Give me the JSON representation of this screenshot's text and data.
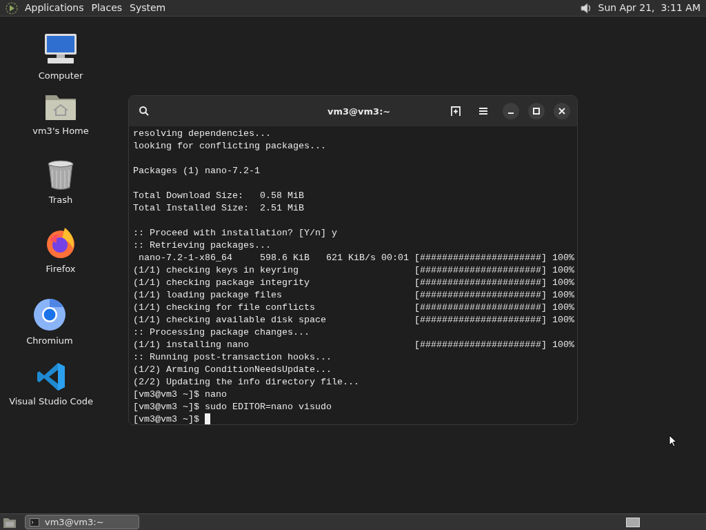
{
  "top_panel": {
    "menus": [
      "Applications",
      "Places",
      "System"
    ],
    "clock": "Sun Apr 21,  3:11 AM"
  },
  "desktop_icons": [
    {
      "kind": "computer",
      "label": "Computer"
    },
    {
      "kind": "home",
      "label": "vm3's Home"
    },
    {
      "kind": "trash",
      "label": "Trash"
    },
    {
      "kind": "firefox",
      "label": "Firefox"
    },
    {
      "kind": "chromium",
      "label": "Chromium"
    },
    {
      "kind": "vscode",
      "label": "Visual Studio Code"
    }
  ],
  "terminal": {
    "title": "vm3@vm3:~",
    "lines": [
      {
        "kind": "text",
        "text": "resolving dependencies..."
      },
      {
        "kind": "text",
        "text": "looking for conflicting packages..."
      },
      {
        "kind": "blank"
      },
      {
        "kind": "text",
        "text": "Packages (1) nano-7.2-1"
      },
      {
        "kind": "blank"
      },
      {
        "kind": "text",
        "text": "Total Download Size:   0.58 MiB"
      },
      {
        "kind": "text",
        "text": "Total Installed Size:  2.51 MiB"
      },
      {
        "kind": "blank"
      },
      {
        "kind": "text",
        "text": ":: Proceed with installation? [Y/n] y"
      },
      {
        "kind": "text",
        "text": ":: Retrieving packages..."
      },
      {
        "kind": "progress",
        "text": " nano-7.2-1-x86_64     598.6 KiB   621 KiB/s 00:01",
        "bar": "[######################]",
        "percent": "100%"
      },
      {
        "kind": "progress",
        "text": "(1/1) checking keys in keyring",
        "bar": "[######################]",
        "percent": "100%"
      },
      {
        "kind": "progress",
        "text": "(1/1) checking package integrity",
        "bar": "[######################]",
        "percent": "100%"
      },
      {
        "kind": "progress",
        "text": "(1/1) loading package files",
        "bar": "[######################]",
        "percent": "100%"
      },
      {
        "kind": "progress",
        "text": "(1/1) checking for file conflicts",
        "bar": "[######################]",
        "percent": "100%"
      },
      {
        "kind": "progress",
        "text": "(1/1) checking available disk space",
        "bar": "[######################]",
        "percent": "100%"
      },
      {
        "kind": "text",
        "text": ":: Processing package changes..."
      },
      {
        "kind": "progress",
        "text": "(1/1) installing nano",
        "bar": "[######################]",
        "percent": "100%"
      },
      {
        "kind": "text",
        "text": ":: Running post-transaction hooks..."
      },
      {
        "kind": "text",
        "text": "(1/2) Arming ConditionNeedsUpdate..."
      },
      {
        "kind": "text",
        "text": "(2/2) Updating the info directory file..."
      },
      {
        "kind": "text",
        "text": "[vm3@vm3 ~]$ nano"
      },
      {
        "kind": "text",
        "text": "[vm3@vm3 ~]$ sudo EDITOR=nano visudo"
      },
      {
        "kind": "cursor",
        "text": "[vm3@vm3 ~]$"
      }
    ]
  },
  "taskbar": {
    "tasks": [
      {
        "label": "vm3@vm3:~",
        "selected": true
      }
    ]
  }
}
